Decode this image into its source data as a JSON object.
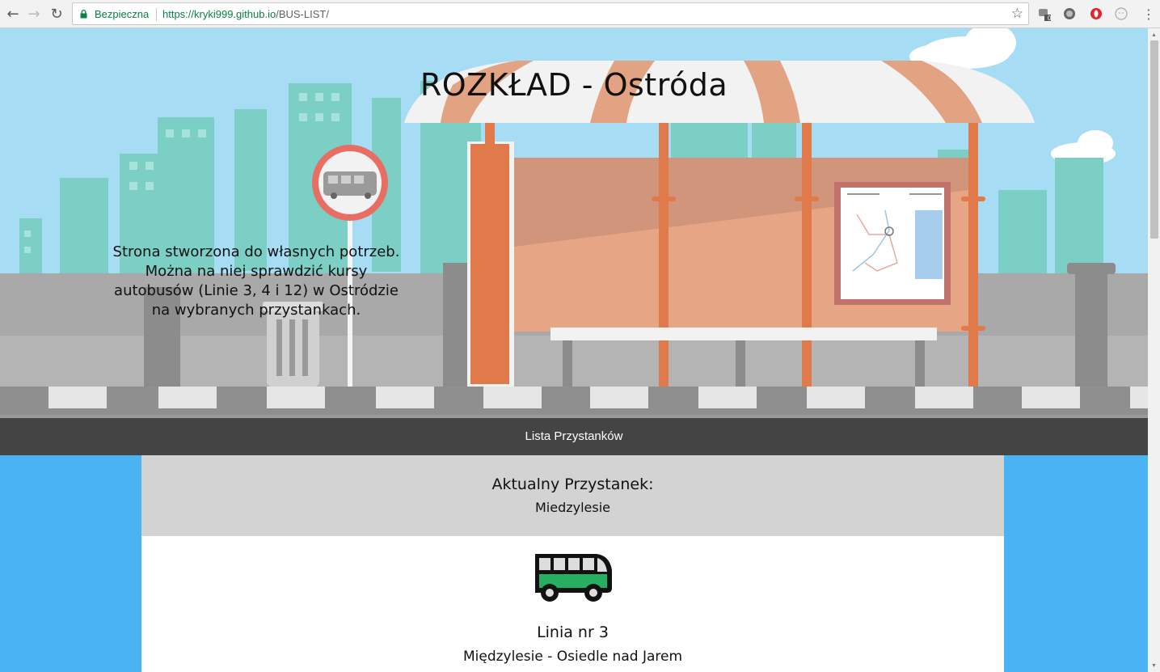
{
  "browser": {
    "secure_label": "Bezpieczna",
    "url_host": "https://kryki999.github.io",
    "url_path": "/BUS-LIST/",
    "extension_badge": "0"
  },
  "hero": {
    "title": "ROZKŁAD - Ostróda",
    "description": "Strona stworzona do własnych potrzeb. Można na niej sprawdzić kursy autobusów (Linie 3, 4 i 12) w Ostródzie na wybranych przystankach."
  },
  "nav": {
    "stops_link": "Lista Przystanków"
  },
  "current_stop": {
    "label": "Aktualny Przystanek:",
    "name": "Miedzylesie"
  },
  "line": {
    "number": "Linia nr 3",
    "route": "Międzylesie - Osiedle nad Jarem"
  },
  "colors": {
    "sky": "#a7dcf5",
    "buildings": "#7bcfc4",
    "shelter_orange": "#e07a4a",
    "navbar": "#444444",
    "main_blue": "#4ab3f4",
    "bus_green": "#27ae60"
  }
}
